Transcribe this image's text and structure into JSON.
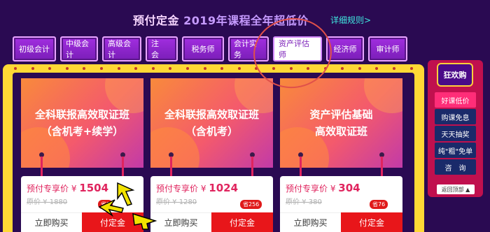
{
  "header": {
    "title_pre": "预付定金 ",
    "title_year": "2019年课程全年超低价",
    "rules_link": "详细规则>"
  },
  "nav": [
    {
      "label": "初级会计"
    },
    {
      "label": "中级会计"
    },
    {
      "label": "高级会计"
    },
    {
      "label": "注　会"
    },
    {
      "label": "税务师"
    },
    {
      "label": "会计实务"
    },
    {
      "label": "资产评估师",
      "active": true
    },
    {
      "label": "经济师"
    },
    {
      "label": "审计师"
    }
  ],
  "cards": [
    {
      "title": "全科联报高效取证班\n（含机考+续学）",
      "price_label": "预付专享价 ¥ ",
      "price": "1504",
      "orig": "原价 ¥ 1880",
      "save": "省3",
      "buy": "立即购买",
      "deposit": "付定金"
    },
    {
      "title": "全科联报高效取证班\n（含机考）",
      "price_label": "预付专享价 ¥ ",
      "price": "1024",
      "orig": "原价 ¥ 1280",
      "save": "省256",
      "buy": "立即购买",
      "deposit": "付定金"
    },
    {
      "title": "资产评估基础\n高效取证班",
      "price_label": "预付专享价 ¥ ",
      "price": "304",
      "orig": "原价 ¥ 380",
      "save": "省76",
      "buy": "立即购买",
      "deposit": "付定金"
    }
  ],
  "sidebar": {
    "head": "狂欢购",
    "items": [
      "好课低价",
      "购课免息",
      "天天抽奖",
      "纯\"粗\"免单",
      "咨　询"
    ],
    "active_index": 0,
    "back_top": "返回顶部 ▲"
  },
  "colors": {
    "background": "#2a0a52",
    "stage_border": "#ffd835",
    "accent_red": "#e8161a",
    "price_pink": "#e0245e",
    "link_cyan": "#40e8e0",
    "annotation_circle": "#e0504a",
    "annotation_arrow": "#f2e200"
  }
}
